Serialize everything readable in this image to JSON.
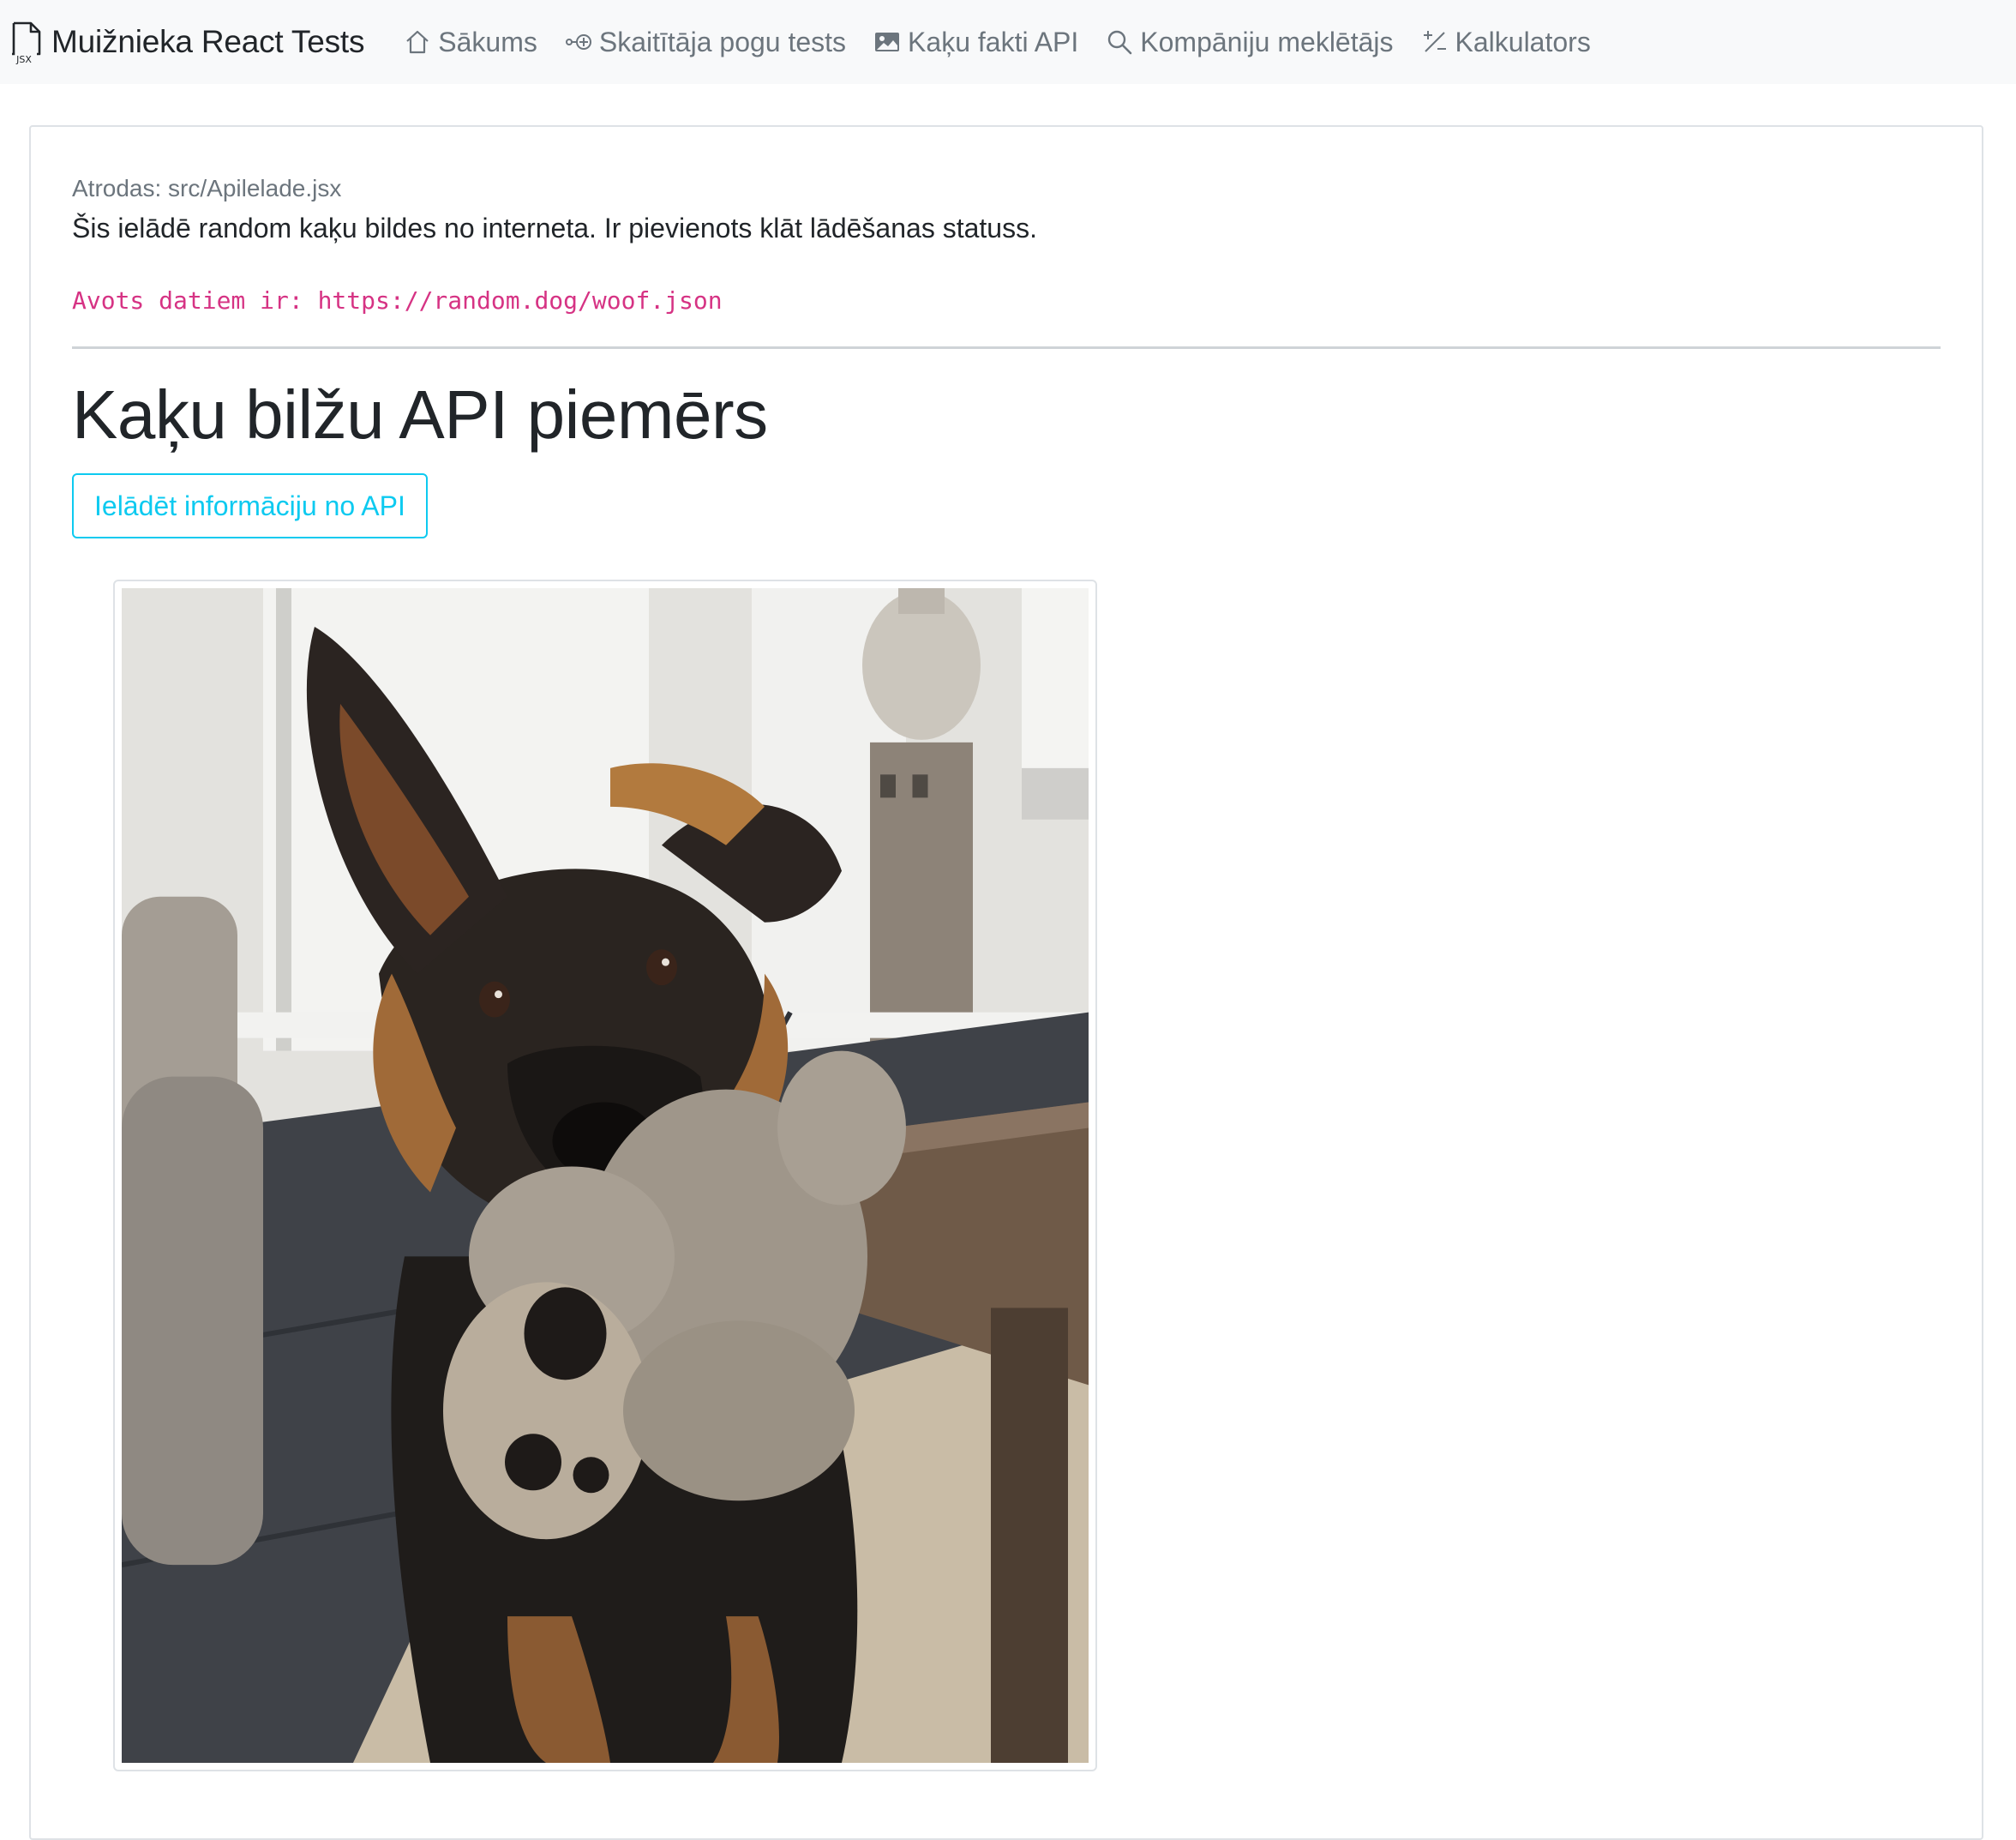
{
  "navbar": {
    "brand": "Muižnieka React Tests",
    "brand_icon": "jsx-file-icon",
    "links": [
      {
        "label": "Sākums",
        "icon": "house-icon"
      },
      {
        "label": "Skaitītāja pogu tests",
        "icon": "node-plus-icon"
      },
      {
        "label": "Kaķu fakti API",
        "icon": "image-icon"
      },
      {
        "label": "Kompāniju meklētājs",
        "icon": "search-icon"
      },
      {
        "label": "Kalkulators",
        "icon": "plus-slash-minus-icon"
      }
    ]
  },
  "main": {
    "location": "Atrodas: src/Apilelade.jsx",
    "description": "Šis ielādē random kaķu bildes no interneta. Ir pievienots klāt lādēšanas statuss.",
    "source": "Avots datiem ir: https://random.dog/woof.json",
    "title": "Kaķu bilžu API piemērs",
    "load_button": "Ielādēt informāciju no API",
    "image_subject": "german-shepherd-puppy-with-teddy-bear"
  },
  "colors": {
    "navbar_bg": "#f8f9fa",
    "nav_link": "#6c757d",
    "code_pink": "#d63384",
    "button_info": "#0dcaf0",
    "border": "#dee2e6"
  }
}
